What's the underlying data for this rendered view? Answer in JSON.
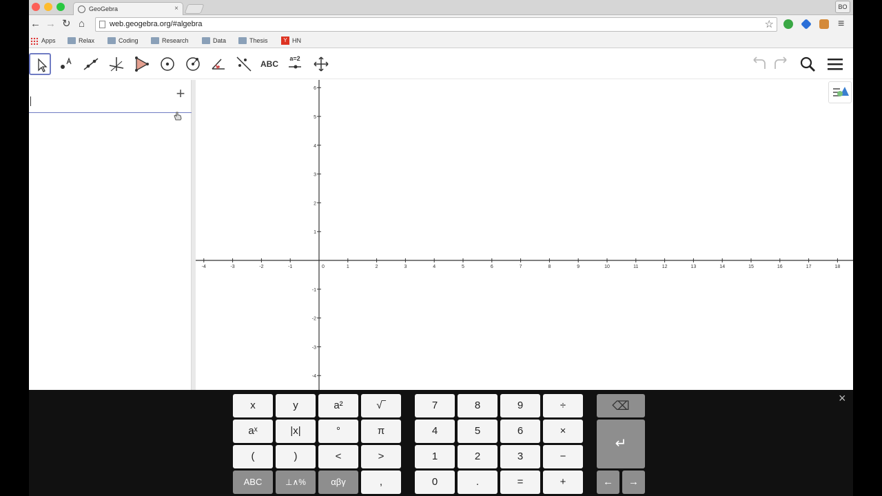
{
  "browser": {
    "tab_title": "GeoGebra",
    "tab_close": "×",
    "url": "web.geogebra.org/#algebra",
    "profile": "BO",
    "bookmarks": [
      "Apps",
      "Relax",
      "Coding",
      "Research",
      "Data",
      "Thesis",
      "HN"
    ],
    "hn_badge": "Y"
  },
  "toolbar": {
    "abc_label": "ABC",
    "slider_label": "a=2"
  },
  "algebra": {
    "input_value": "",
    "add_label": "+"
  },
  "graphics": {
    "x_ticks": [
      "-4",
      "-3",
      "-2",
      "-1",
      "0",
      "1",
      "2",
      "3",
      "4",
      "5",
      "6",
      "7",
      "8",
      "9",
      "10",
      "11",
      "12",
      "13",
      "14",
      "15",
      "16",
      "17",
      "18"
    ],
    "y_ticks": [
      "6",
      "5",
      "4",
      "3",
      "2",
      "1",
      "-1",
      "-2",
      "-3",
      "-4"
    ],
    "x_range": [
      -4,
      18
    ],
    "y_range": [
      -4,
      6
    ],
    "grid": false
  },
  "keyboard": {
    "close": "×",
    "rows": [
      [
        "x",
        "y",
        "a²",
        "√‾",
        "7",
        "8",
        "9",
        "÷",
        "⌫"
      ],
      [
        "aˣ",
        "|x|",
        "°",
        "π",
        "4",
        "5",
        "6",
        "×",
        "↵"
      ],
      [
        "(",
        ")",
        "<",
        ">",
        "1",
        "2",
        "3",
        "−"
      ],
      [
        "ABC",
        "⊥∧%",
        "αβγ",
        ",",
        "0",
        ".",
        "=",
        "+",
        "←",
        "→"
      ]
    ]
  },
  "colors": {
    "accent": "#6f7bc3",
    "keyboard_bg": "#111111",
    "key_light": "#f4f4f4",
    "key_dark": "#8e8e8e"
  }
}
